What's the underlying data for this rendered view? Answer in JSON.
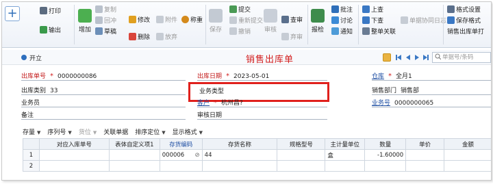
{
  "toolbar": {
    "print": "打印",
    "export": "输出",
    "add": "增加",
    "copy": "复制",
    "draft": "草稿",
    "rollback": "回冲",
    "modify": "修改",
    "attach": "附件",
    "weigh": "称重",
    "delete": "删除",
    "abandon": "放弃",
    "save": "保存",
    "submit": "提交",
    "resubmit": "重新提交",
    "withdraw": "撤销",
    "audit": "审核",
    "check": "查审",
    "abandon2": "弃审",
    "post": "报检",
    "approve_note": "批注",
    "discuss": "讨论",
    "notify": "通知",
    "prev": "上查",
    "next": "下查",
    "whole_link": "整单关联",
    "collab_log": "单据协同日志",
    "format_settings": "格式设置",
    "save_format": "保存格式",
    "sales_print": "销售出库单打"
  },
  "titlebar": {
    "open": "开立",
    "title": "销售出库单",
    "search_placeholder": "单据号/条码"
  },
  "header": {
    "outbound_no_label": "出库单号",
    "outbound_no": "0000000086",
    "outbound_date_label": "出库日期",
    "outbound_date": "2023-05-01",
    "warehouse_label": "仓库",
    "warehouse": "全月1",
    "outbound_type_label": "出库类别",
    "outbound_type": "33",
    "business_type_label": "业务类型",
    "business_type": "",
    "sales_dept_label": "销售部门",
    "sales_dept": "销售部",
    "salesperson_label": "业务员",
    "salesperson": "",
    "customer_label": "客户",
    "customer": "杭州昌?",
    "business_no_label": "业务号",
    "business_no": "0000000065",
    "remark_label": "备注",
    "remark": "",
    "audit_date_label": "审核日期",
    "audit_date": ""
  },
  "gridbar": {
    "stock": "存量",
    "serial": "序列号",
    "slot": "货位",
    "related": "关联单据",
    "sort": "排序定位",
    "display": "显示格式"
  },
  "grid": {
    "columns": [
      "",
      "对应入库单号",
      "表体自定义项1",
      "存货编码",
      "存货名称",
      "规格型号",
      "主计量单位",
      "数量",
      "单价",
      "金额"
    ],
    "rows": [
      [
        "1",
        "",
        "",
        "000006",
        "44",
        "",
        "盒",
        "-1.60000",
        "",
        ""
      ],
      [
        "2",
        "",
        "",
        "",
        "",
        "",
        "",
        "",
        "",
        ""
      ]
    ]
  }
}
